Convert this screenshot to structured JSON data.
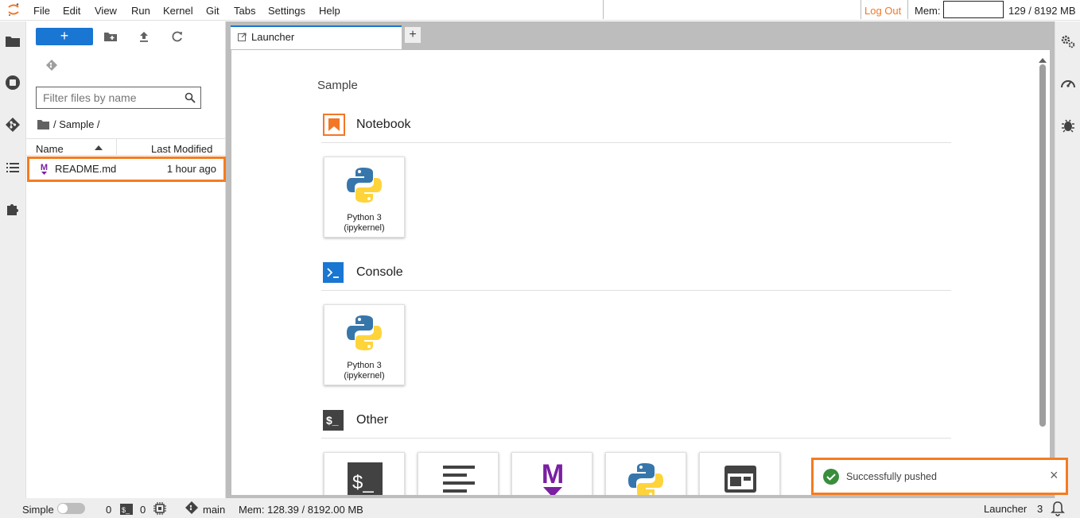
{
  "menubar": {
    "items": [
      "File",
      "Edit",
      "View",
      "Run",
      "Kernel",
      "Git",
      "Tabs",
      "Settings",
      "Help"
    ],
    "logout": "Log Out",
    "mem_label": "Mem:",
    "mem_value": "129 / 8192 MB"
  },
  "filebrowser": {
    "filter_placeholder": "Filter files by name",
    "breadcrumb": "/ Sample /",
    "columns": {
      "name": "Name",
      "modified": "Last Modified"
    },
    "files": [
      {
        "name": "README.md",
        "modified": "1 hour ago"
      }
    ]
  },
  "tabs": {
    "launcher": "Launcher",
    "add": "+"
  },
  "launcher": {
    "cwd": "Sample",
    "sections": {
      "notebook": {
        "title": "Notebook",
        "cards": [
          {
            "label": "Python 3\n(ipykernel)"
          }
        ]
      },
      "console": {
        "title": "Console",
        "cards": [
          {
            "label": "Python 3\n(ipykernel)"
          }
        ]
      },
      "other": {
        "title": "Other"
      }
    }
  },
  "toast": {
    "message": "Successfully pushed",
    "close": "×"
  },
  "statusbar": {
    "mode": "Simple",
    "kernels": "0",
    "terminals": "0",
    "branch": "main",
    "mem": "Mem: 128.39 / 8192.00 MB",
    "launcher": "Launcher",
    "count": "3"
  },
  "colors": {
    "accent": "#1976d2",
    "orange": "#f37726",
    "highlight": "#f57c1f",
    "success": "#388e3c",
    "markdown": "#7b1fa2"
  }
}
